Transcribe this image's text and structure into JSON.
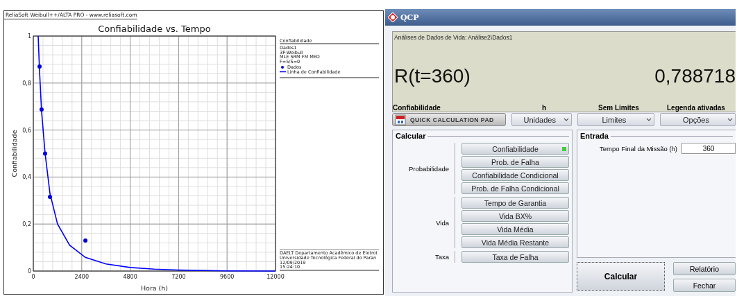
{
  "chart_window": {
    "title": "ReliaSoft Weibull++/ALTA PRO - www.reliasoft.com",
    "chart_data": {
      "type": "line",
      "title": "Confiabilidade vs. Tempo",
      "xlabel": "Hora (h)",
      "ylabel": "Confiabilidade",
      "x": [
        240,
        310,
        410,
        585,
        825,
        1200,
        1800,
        2580,
        3600,
        4800,
        6000,
        7200,
        9600,
        12000
      ],
      "series": [
        {
          "name": "Dados",
          "type": "scatter",
          "color": "#0000cc",
          "values": [
            null,
            0.87,
            0.687,
            0.5,
            0.316,
            null,
            null,
            0.13,
            null,
            null,
            null,
            null,
            null,
            null
          ]
        },
        {
          "name": "Linha de Confiabilidade",
          "color": "#0000ff",
          "values": [
            1,
            0.85,
            0.68,
            0.5,
            0.33,
            0.2,
            0.11,
            0.058,
            0.03,
            0.015,
            0.008,
            0.004,
            0.001,
            0
          ]
        }
      ],
      "xlim": [
        0,
        12000
      ],
      "ylim": [
        0,
        1
      ],
      "grid": true,
      "xticks": [
        0,
        2400,
        4800,
        7200,
        9600,
        12000
      ],
      "yticks": [
        0,
        {
          "value": 0.2,
          "label": "0,2"
        },
        {
          "value": 0.4,
          "label": "0,4"
        },
        {
          "value": 0.6,
          "label": "0,6"
        },
        {
          "value": 0.8,
          "label": "0,8"
        },
        1
      ]
    },
    "legend": {
      "heading": "Confiabilidade",
      "lines": [
        "Dados1",
        "3P-Weibull",
        "MLE SRM FM MED",
        "F=5/S=0"
      ]
    },
    "footer": [
      "DAELT Departamento Acadêmico de Eletrot",
      "Universidade Tecnológica Federal do Paran",
      "12/09/2019",
      "15:24:10"
    ]
  },
  "qcp": {
    "title": "QCP",
    "display": {
      "path": "Análises de Dados de Vida: Análise2\\Dados1",
      "expression": "R(t=360)",
      "result": "0,788718",
      "captions": [
        "Confiabilidade",
        "h",
        "Sem Limites",
        "Legenda ativadas"
      ]
    },
    "pad_button": "QUICK CALCULATION PAD",
    "dropdowns": [
      {
        "label": "Unidades"
      },
      {
        "label": "Limites"
      },
      {
        "label": "Opções"
      }
    ],
    "calcular": {
      "title": "Calcular",
      "groups": [
        {
          "label": "Probabilidade",
          "buttons": [
            {
              "label": "Confiabilidade",
              "selected": true
            },
            {
              "label": "Prob. de Falha",
              "selected": false
            },
            {
              "label": "Confiabilidade Condicional",
              "selected": false
            },
            {
              "label": "Prob. de Falha Condicional",
              "selected": false
            }
          ]
        },
        {
          "label": "Vida",
          "buttons": [
            {
              "label": "Tempo de Garantia",
              "selected": false
            },
            {
              "label": "Vida BX%",
              "selected": false
            },
            {
              "label": "Vida Média",
              "selected": false
            },
            {
              "label": "Vida Média Restante",
              "selected": false
            }
          ]
        },
        {
          "label": "Taxa",
          "buttons": [
            {
              "label": "Taxa de Falha",
              "selected": false
            }
          ]
        }
      ]
    },
    "entrada": {
      "title": "Entrada",
      "fields": [
        {
          "label": "Tempo Final da Missão (h)",
          "value": "360"
        }
      ]
    },
    "actions": {
      "primary": "Calcular",
      "secondary": [
        "Relatório",
        "Fechar"
      ]
    }
  }
}
